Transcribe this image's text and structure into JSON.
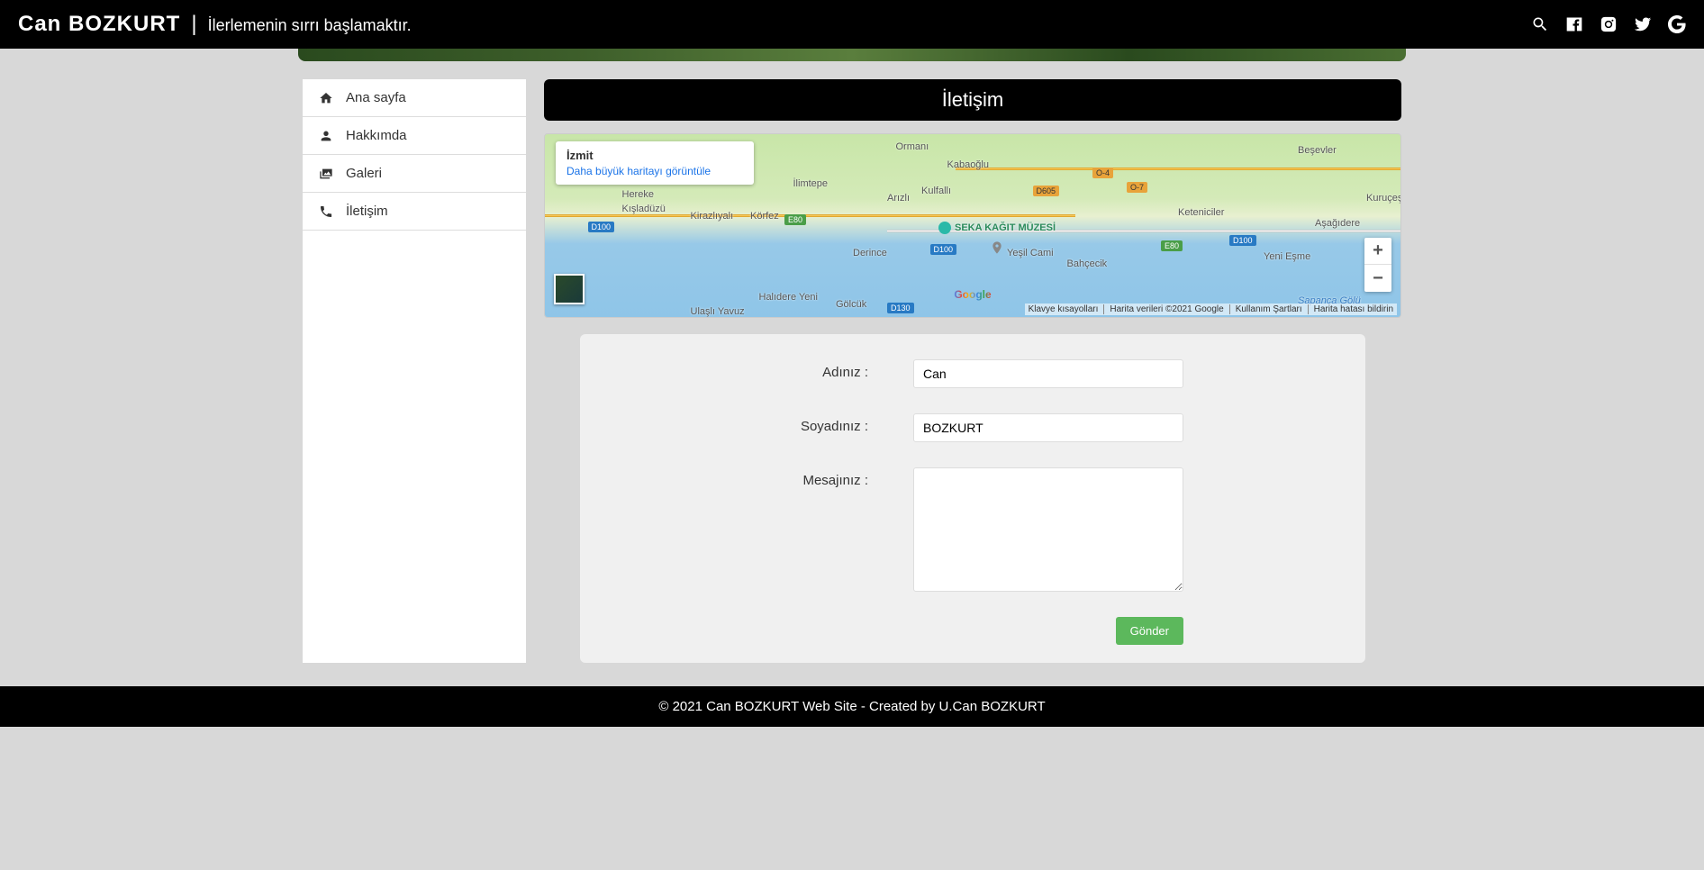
{
  "header": {
    "site_title": "Can BOZKURT",
    "tagline": "İlerlemenin sırrı başlamaktır."
  },
  "sidebar": {
    "items": [
      {
        "label": "Ana sayfa",
        "icon": "home"
      },
      {
        "label": "Hakkımda",
        "icon": "user"
      },
      {
        "label": "Galeri",
        "icon": "images"
      },
      {
        "label": "İletişim",
        "icon": "phone"
      }
    ]
  },
  "page": {
    "title": "İletişim"
  },
  "map": {
    "popup_title": "İzmit",
    "popup_link": "Daha büyük haritayı görüntüle",
    "labels": {
      "ormani": "Ormanı",
      "kabaoglu": "Kabaoğlu",
      "kullar": "Kulfallı",
      "arizli": "Arızlı",
      "hereke": "Hereke",
      "kisladuzu": "Kışladüzü",
      "kirazliyali": "Kirazlıyalı",
      "korfez": "Körfez",
      "ilimtepe": "İlimtepe",
      "derince": "Derince",
      "golcuk": "Gölcük",
      "halidere": "Halıdere Yeni",
      "ulasli": "Ulaşlı Yavuz",
      "yesilcami": "Yeşil Cami",
      "bahcecik": "Bahçecik",
      "besevler": "Beşevler",
      "kuruceşme": "Kuruçeşme",
      "keteniciler": "Keteniciler",
      "yenieşme": "Yeni Eşme",
      "asagidere": "Aşağıdere",
      "sapanca": "Sapanca Gölü",
      "poi_seka": "SEKA KAĞIT MÜZESİ"
    },
    "attrib": {
      "a1": "Klavye kısayolları",
      "a2": "Harita verileri ©2021 Google",
      "a3": "Kullanım Şartları",
      "a4": "Harita hatası bildirin"
    },
    "google_logo": "Google",
    "road_d100": "D100",
    "road_d130": "D130",
    "road_e80": "E80",
    "road_o4": "O-4",
    "road_o7": "O-7",
    "road_d605": "D605"
  },
  "form": {
    "labels": {
      "name": "Adınız :",
      "surname": "Soyadınız :",
      "message": "Mesajınız :"
    },
    "values": {
      "name": "Can",
      "surname": "BOZKURT",
      "message": ""
    },
    "submit": "Gönder"
  },
  "footer": {
    "text": "© 2021 Can BOZKURT Web Site - Created by U.Can BOZKURT"
  }
}
